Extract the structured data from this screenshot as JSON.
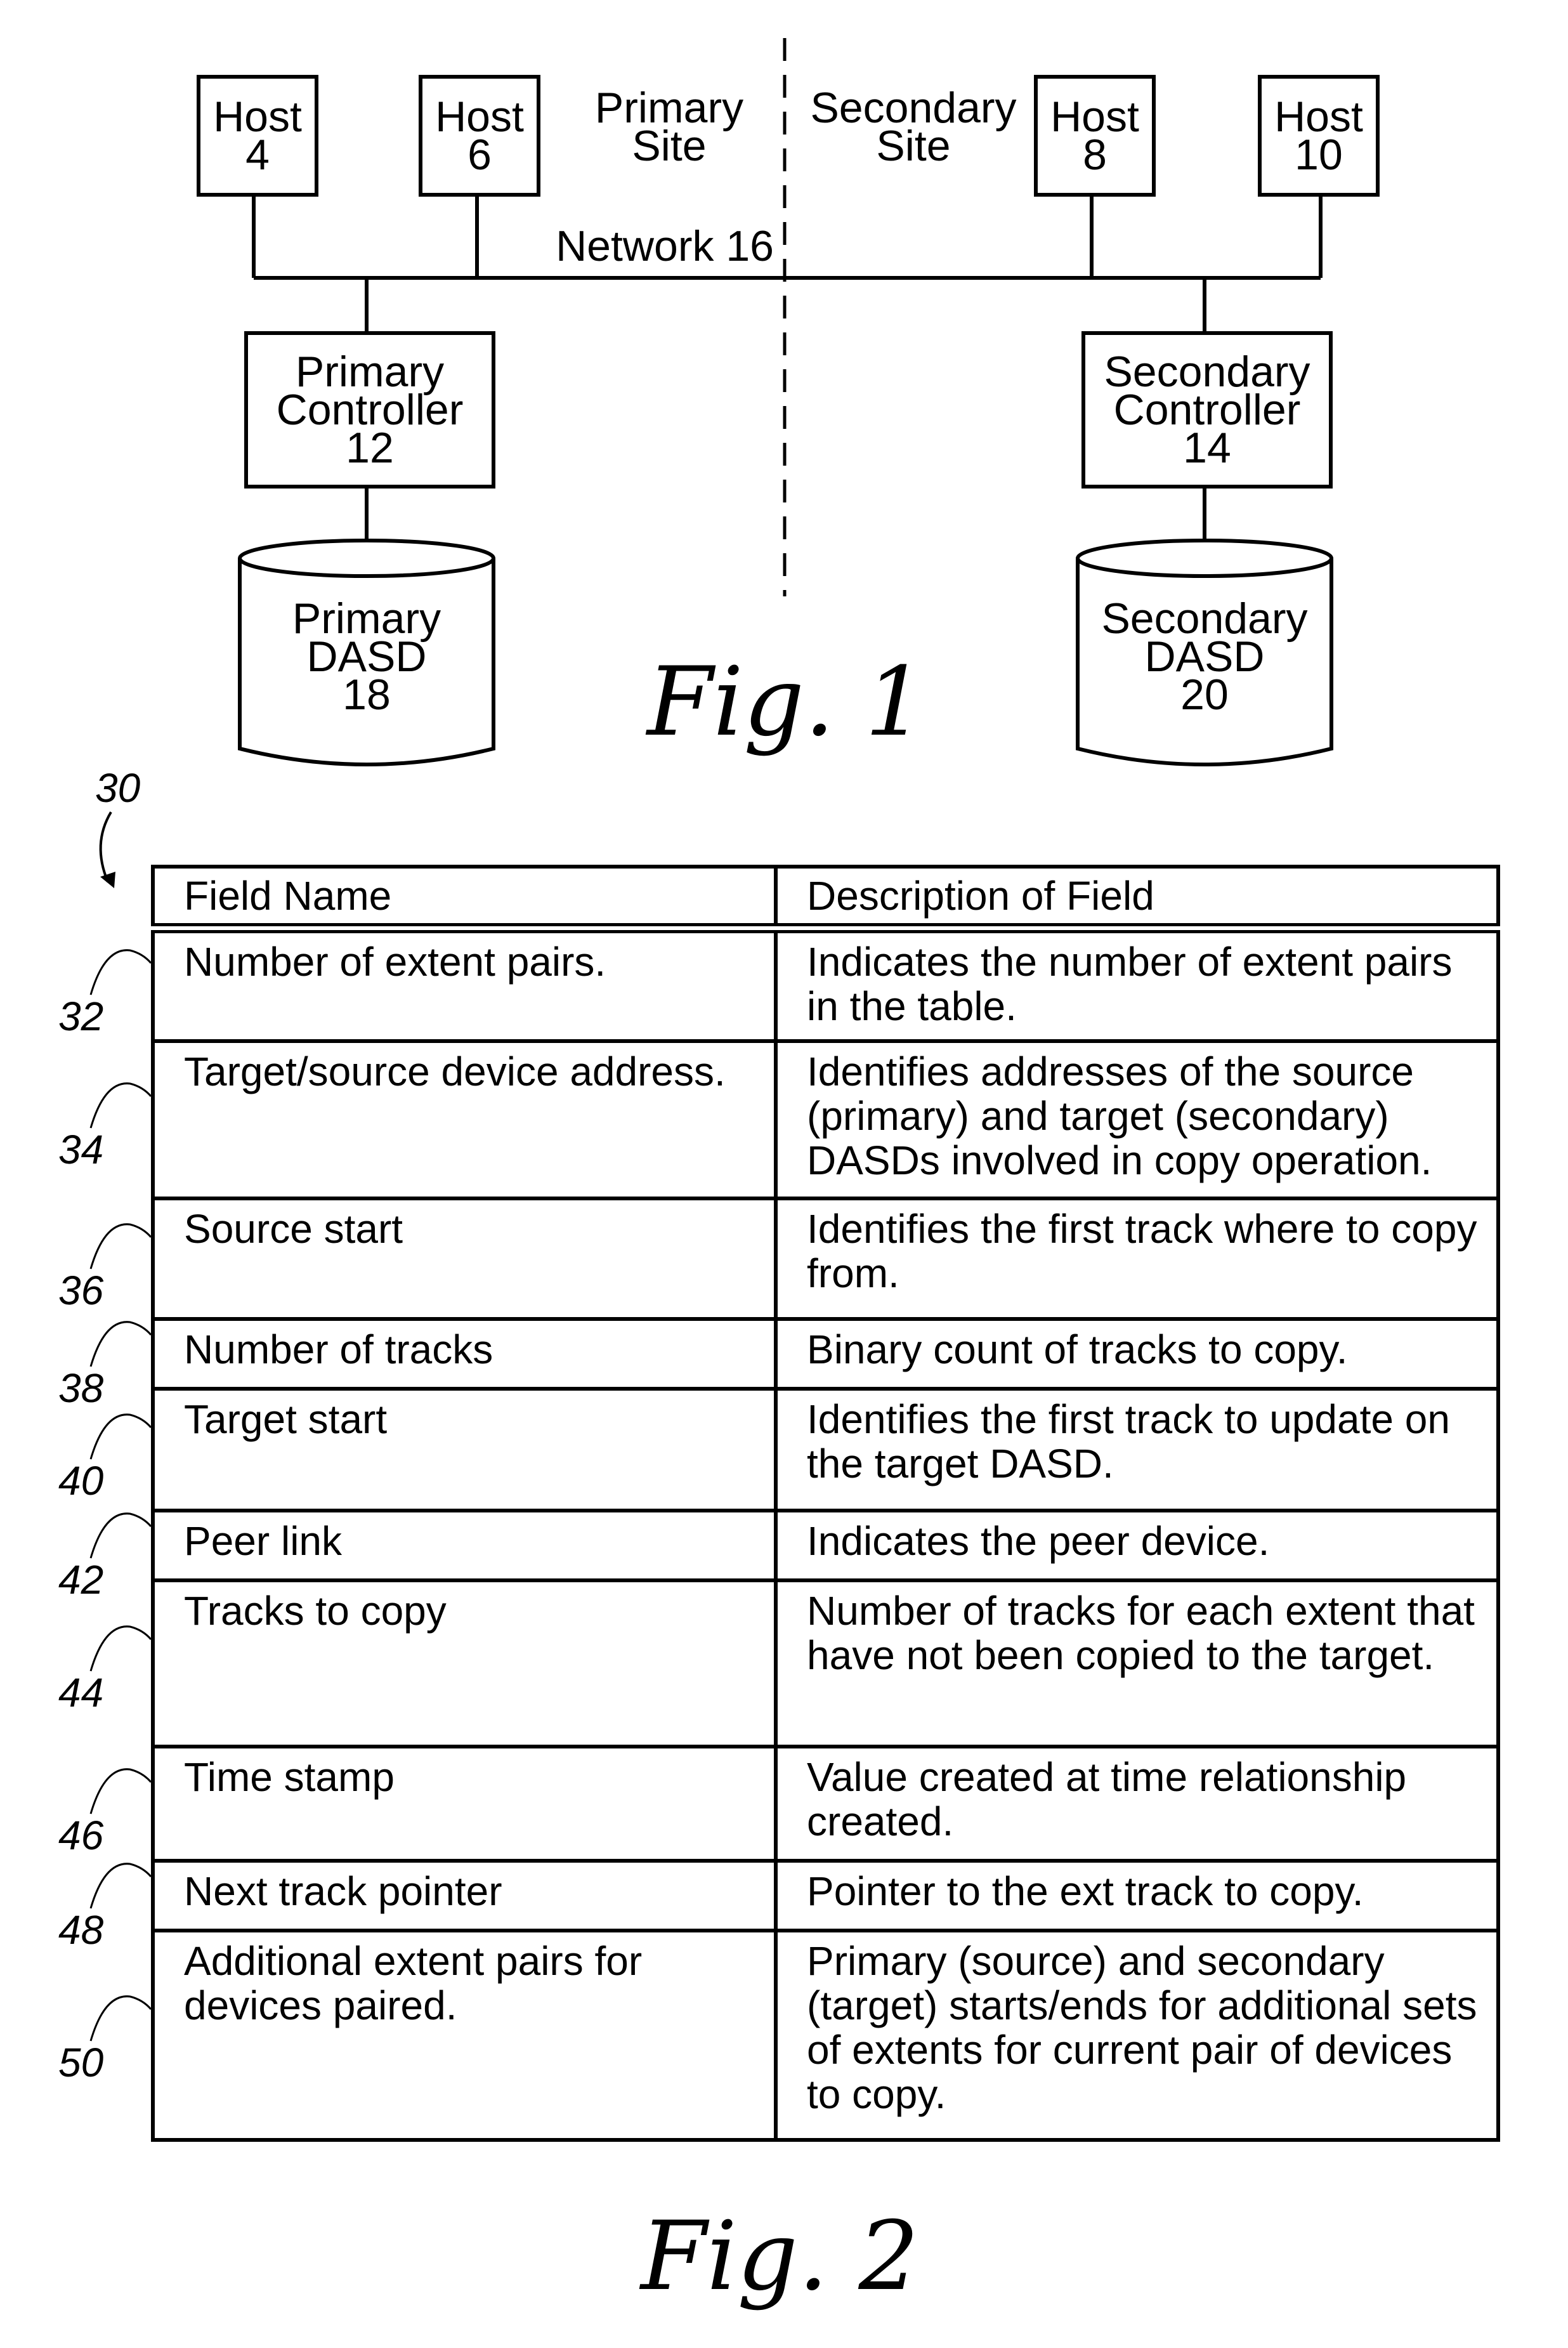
{
  "figure1": {
    "caption": "Fig. 1",
    "primary_site_label": [
      "Primary",
      "Site"
    ],
    "secondary_site_label": [
      "Secondary",
      "Site"
    ],
    "network_label": "Network 16",
    "hosts": [
      {
        "line1": "Host",
        "line2": "4"
      },
      {
        "line1": "Host",
        "line2": "6"
      },
      {
        "line1": "Host",
        "line2": "8"
      },
      {
        "line1": "Host",
        "line2": "10"
      }
    ],
    "primary_controller": [
      "Primary",
      "Controller",
      "12"
    ],
    "secondary_controller": [
      "Secondary",
      "Controller",
      "14"
    ],
    "primary_dasd": [
      "Primary",
      "DASD",
      "18"
    ],
    "secondary_dasd": [
      "Secondary",
      "DASD",
      "20"
    ]
  },
  "figure2": {
    "caption": "Fig. 2",
    "table_ref": "30",
    "headers": [
      "Field Name",
      "Description of Field"
    ],
    "rows": [
      {
        "ref": "32",
        "field": "Number of extent pairs.",
        "description": "Indicates the number of extent pairs in the table."
      },
      {
        "ref": "34",
        "field": "Target/source device address.",
        "description": "Identifies addresses of the source (primary) and target (secondary) DASDs involved in copy operation."
      },
      {
        "ref": "36",
        "field": "Source start",
        "description": "Identifies the first track where to copy from."
      },
      {
        "ref": "38",
        "field": "Number of tracks",
        "description": "Binary count of tracks to copy."
      },
      {
        "ref": "40",
        "field": "Target start",
        "description": "Identifies the first track to update on the target DASD."
      },
      {
        "ref": "42",
        "field": "Peer link",
        "description": "Indicates the peer device."
      },
      {
        "ref": "44",
        "field": "Tracks to copy",
        "description": "Number of tracks for each extent that have not been copied to the target."
      },
      {
        "ref": "46",
        "field": "Time stamp",
        "description": "Value created at time relationship created."
      },
      {
        "ref": "48",
        "field": "Next track pointer",
        "description": "Pointer to the ext track to copy."
      },
      {
        "ref": "50",
        "field": "Additional extent pairs for devices paired.",
        "description": "Primary (source) and secondary (target) starts/ends for additional sets of extents for current pair of devices to copy."
      }
    ]
  }
}
